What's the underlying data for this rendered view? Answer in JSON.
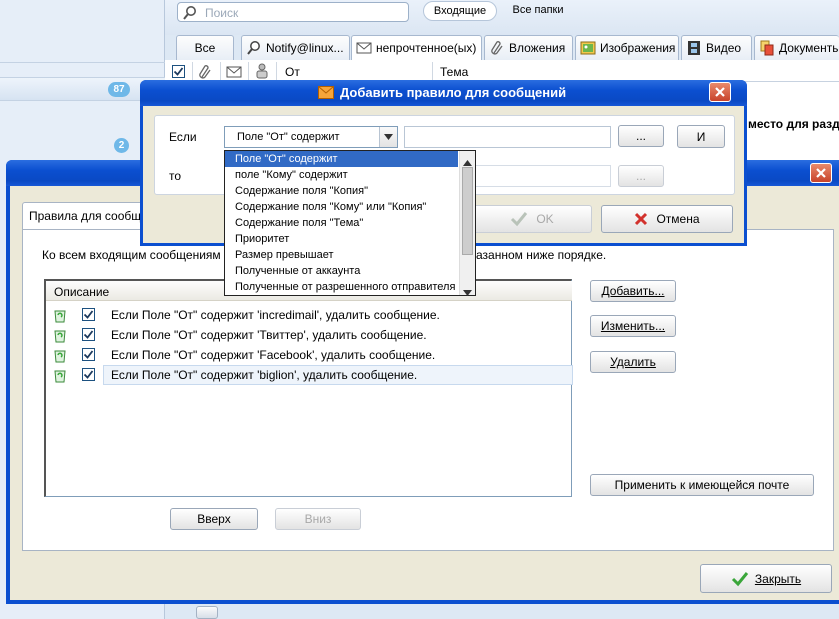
{
  "search": {
    "placeholder": "Поиск"
  },
  "folder_buttons": {
    "inbox": "Входящие",
    "all": "Все папки"
  },
  "tabs": [
    {
      "label": "Все",
      "icon": "none"
    },
    {
      "label": "Notify@linux...",
      "icon": "search-icon"
    },
    {
      "label": "непрочтенное(ых)",
      "icon": "envelope-icon"
    },
    {
      "label": "Вложения",
      "icon": "paperclip-icon"
    },
    {
      "label": "Изображения",
      "icon": "image-icon"
    },
    {
      "label": "Видео",
      "icon": "film-icon"
    },
    {
      "label": "Документы",
      "icon": "document-icon"
    }
  ],
  "columns": {
    "from": "От",
    "subject": "Тема"
  },
  "badges": {
    "count1": "87",
    "count2": "2"
  },
  "background_text": {
    "partial_right": "место для разд"
  },
  "add_rule_dialog": {
    "title": "Добавить правило для сообщений",
    "if_label": "Если",
    "then_label": "то",
    "condition_selected": "Поле \"От\" содержит",
    "ellipsis": "...",
    "and_button": "И",
    "ok_button": "OK",
    "cancel_button": "Отмена",
    "dropdown_options": [
      "Поле \"От\" содержит",
      "поле \"Кому\" содержит",
      "Содержание поля \"Копия\"",
      "Содержание поля \"Кому\" или \"Копия\"",
      "Содержание поля \"Тема\"",
      "Приоритет",
      "Размер превышает",
      "Полученные от аккаунта",
      "Полученные от разрешенного отправителя"
    ]
  },
  "rules_window": {
    "group_title": "Правила для сообщ",
    "description_left": "Ко всем входящим сообщениям",
    "description_right": "азанном ниже порядке.",
    "column_header": "Описание",
    "rules": [
      {
        "text": "Если Поле \"От\" содержит 'incredimail', удалить сообщение.",
        "enabled": true
      },
      {
        "text": "Если Поле \"От\" содержит 'Твиттер', удалить сообщение.",
        "enabled": true
      },
      {
        "text": "Если Поле \"От\" содержит 'Facebook', удалить сообщение.",
        "enabled": true
      },
      {
        "text": "Если Поле \"От\" содержит 'biglion', удалить сообщение.",
        "enabled": true
      }
    ],
    "buttons": {
      "add": "Добавить...",
      "edit": "Изменить...",
      "delete": "Удалить",
      "apply": "Применить к имеющейся почте",
      "up": "Вверх",
      "down": "Вниз",
      "close": "Закрыть"
    }
  },
  "colors": {
    "title_blue": "#0b4fd0",
    "selection": "#316ac5",
    "badge": "#6fb8e8",
    "close_red": "#c8432a",
    "check_green": "#3aa63a"
  }
}
